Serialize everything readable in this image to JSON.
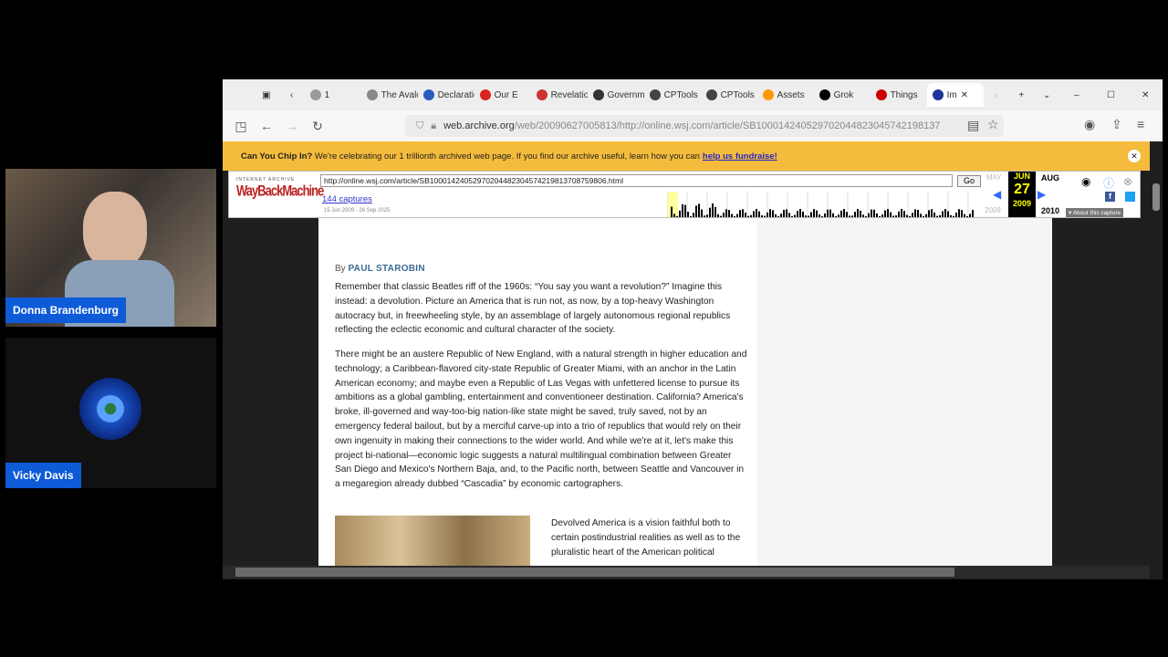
{
  "participants": [
    {
      "name": "Donna Brandenburg"
    },
    {
      "name": "Vicky Davis"
    }
  ],
  "browser": {
    "tabs": [
      {
        "label": "1",
        "color": "#999"
      },
      {
        "label": "The Avalon",
        "color": "#888"
      },
      {
        "label": "Declaration",
        "color": "#2a5bbf"
      },
      {
        "label": "Our E",
        "color": "#d22"
      },
      {
        "label": "Revelation",
        "color": "#c33"
      },
      {
        "label": "Government",
        "color": "#333"
      },
      {
        "label": "CPTools",
        "color": "#444"
      },
      {
        "label": "CPTools",
        "color": "#444"
      },
      {
        "label": "Assets",
        "color": "#f90"
      },
      {
        "label": "Grok",
        "color": "#000"
      },
      {
        "label": "Things",
        "color": "#c00"
      },
      {
        "label": "Im",
        "color": "#223399",
        "active": true
      }
    ],
    "url_domain": "web.archive.org",
    "url_path": "/web/20090627005813/http://online.wsj.com/article/SB100014240529702044823045742198137"
  },
  "banner": {
    "lead": "Can You Chip In?",
    "text": " We're celebrating our 1 trillionth archived web page. If you find our archive useful, learn how you can",
    "link": "help us fundraise!"
  },
  "wayback": {
    "logo_top": "INTERNET ARCHIVE",
    "logo": "WayBackMachine",
    "url_value": "http://online.wsj.com/article/SB10001424052970204482304574219813708759806.html",
    "go": "Go",
    "captures": "144 captures",
    "range": "15 Jun 2009 - 26 Sep 2025",
    "prev_month": "MAY",
    "cur_month": "JUN",
    "next_month": "AUG",
    "day": "27",
    "prev_year": "2008",
    "cur_year": "2009",
    "next_year": "2010",
    "about": "About this capture"
  },
  "article": {
    "by": "By",
    "author": "PAUL STAROBIN",
    "p1": "Remember that classic Beatles riff of the 1960s: “You say you want a revolution?” Imagine this instead: a devolution. Picture an America that is run not, as now, by a top-heavy Washington autocracy but, in freewheeling style, by an assemblage of largely autonomous regional republics reflecting the eclectic economic and cultural character of the society.",
    "p2": "There might be an austere Republic of New England, with a natural strength in higher education and technology; a Caribbean-flavored city-state Republic of Greater Miami, with an anchor in the Latin American economy; and maybe even a Republic of Las Vegas with unfettered license to pursue its ambitions as a global gambling, entertainment and conventioneer destination. California? America's broke, ill-governed and way-too-big nation-like state might be saved, truly saved, not by an emergency federal bailout, but by a merciful carve-up into a trio of republics that would rely on their own ingenuity in making their connections to the wider world. And while we're at it, let's make this project bi-national—economic logic suggests a natural multilingual combination between Greater San Diego and Mexico's Northern Baja, and, to the Pacific north, between Seattle and Vancouver in a megaregion already dubbed “Cascadia” by economic cartographers.",
    "p3": "Devolved America is a vision faithful both to certain postindustrial realities as well as to the pluralistic heart of the American political"
  }
}
